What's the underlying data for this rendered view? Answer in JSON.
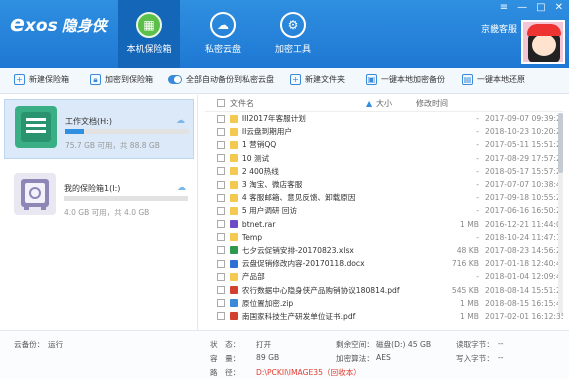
{
  "app": {
    "logo_en": "e",
    "logo_en2": "xos",
    "logo_cn": "隐身侠",
    "username": "京畿客服"
  },
  "tabs": [
    {
      "label": "本机保险箱",
      "icon": "safe-icon",
      "active": true
    },
    {
      "label": "私密云盘",
      "icon": "cloud-icon",
      "active": false
    },
    {
      "label": "加密工具",
      "icon": "gear-icon",
      "active": false
    }
  ],
  "window": {
    "menu": "≡",
    "minimize": "—",
    "maximize": "□",
    "close": "✕"
  },
  "toolbar": {
    "new_safe": "新建保险箱",
    "encrypt_to_safe": "加密到保险箱",
    "backup_all": "全部自动备份到私密云盘",
    "new_folder": "新建文件夹",
    "local_backup": "一键本地加密备份",
    "local_restore": "一键本地还原"
  },
  "safes": [
    {
      "name": "工作文档(H:)",
      "size_text": "75.7 GB 可用，共 88.8 GB",
      "used_fraction": 0.15,
      "selected": true
    },
    {
      "name": "我的保险箱1(I:)",
      "size_text": "4.0 GB 可用，共 4.0 GB",
      "used_fraction": 0.0,
      "selected": false
    }
  ],
  "list_header": {
    "name": "文件名",
    "size": "大小",
    "time": "修改时间",
    "sort": "▲"
  },
  "files": [
    {
      "name": "III2017年客服计划",
      "type": "folder",
      "size": "-",
      "time": "2017-09-07 09:39:27"
    },
    {
      "name": "II云盘到期用户",
      "type": "folder",
      "size": "-",
      "time": "2018-10-23 10:20:25"
    },
    {
      "name": "1 营销QQ",
      "type": "folder",
      "size": "-",
      "time": "2017-05-11 15:51:24"
    },
    {
      "name": "10 测试",
      "type": "folder",
      "size": "-",
      "time": "2017-08-29 17:57:20"
    },
    {
      "name": "2 400热线",
      "type": "folder",
      "size": "-",
      "time": "2018-05-17 15:57:24"
    },
    {
      "name": "3 淘宝、微店客服",
      "type": "folder",
      "size": "-",
      "time": "2017-07-07 10:38:46"
    },
    {
      "name": "4 客服邮箱、意见反馈、卸载原因",
      "type": "folder",
      "size": "-",
      "time": "2017-09-18 10:55:29"
    },
    {
      "name": "5 用户调研 回访",
      "type": "folder",
      "size": "-",
      "time": "2017-06-16 16:50:20"
    },
    {
      "name": "btnet.rar",
      "type": "rar",
      "size": "1 MB",
      "time": "2016-12-21 11:44:03"
    },
    {
      "name": "Temp",
      "type": "folder",
      "size": "-",
      "time": "2018-10-24 11:47:19"
    },
    {
      "name": "七夕云促销安排-20170823.xlsx",
      "type": "xlsx",
      "size": "48 KB",
      "time": "2017-08-23 14:56:28"
    },
    {
      "name": "云盘促销修改内容-20170118.docx",
      "type": "docx",
      "size": "716 KB",
      "time": "2017-01-18 12:40:45"
    },
    {
      "name": "产品部",
      "type": "folder",
      "size": "-",
      "time": "2018-01-04 12:09:44"
    },
    {
      "name": "农行数据中心隐身侠产品购销协议180814.pdf",
      "type": "pdf",
      "size": "545 KB",
      "time": "2018-08-14 15:51:29"
    },
    {
      "name": "原位置加密.zip",
      "type": "zip",
      "size": "1 MB",
      "time": "2018-08-15 16:15:48"
    },
    {
      "name": "南国家科技生产研发单位证书.pdf",
      "type": "pdf",
      "size": "1 MB",
      "time": "2017-02-01 16:12:35"
    }
  ],
  "status": {
    "cloud_backup_label": "云备份：",
    "cloud_backup_value": "运行",
    "state_label": "状　态：",
    "state_value": "打开",
    "drive_label": "盘　符：",
    "drive_value": "H:",
    "capacity_label": "容　量：",
    "capacity_value": "89 GB",
    "path_label": "路　径：",
    "path_value": "D:\\PCKIl\\IMAGE35（回收本）",
    "remaining_label": "剩余空间：",
    "remaining_value": "磁盘(D:) 45 GB",
    "algo_label": "加密算法：",
    "algo_value": "AES",
    "read_label": "读取字节：",
    "read_value": "--",
    "write_label": "写入字节：",
    "write_value": "--"
  },
  "colors": {
    "header": "#1e78d3",
    "active_tab": "#1467b8",
    "selection": "#dbe9f8",
    "path_red": "#e23b2e"
  }
}
